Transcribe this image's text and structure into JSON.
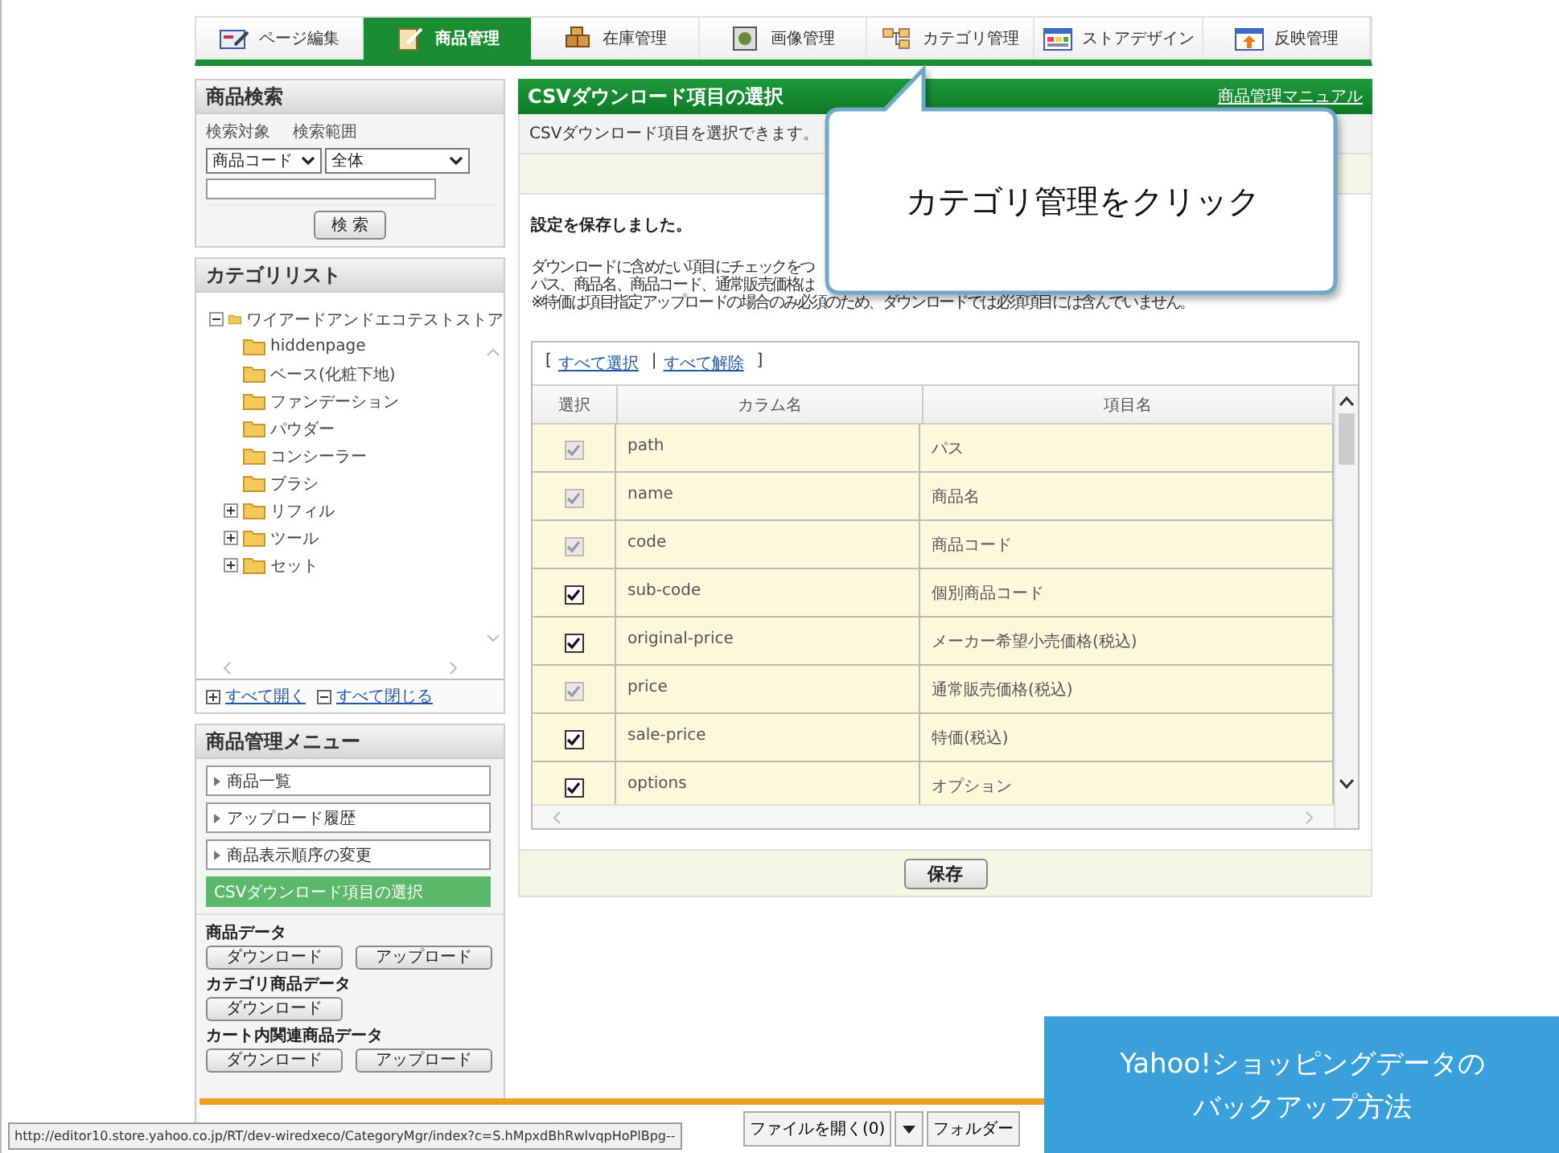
{
  "nav_tabs": [
    {
      "label": "ページ編集",
      "selected": false
    },
    {
      "label": "商品管理",
      "selected": true
    },
    {
      "label": "在庫管理",
      "selected": false
    },
    {
      "label": "画像管理",
      "selected": false
    },
    {
      "label": "カテゴリ管理",
      "selected": false
    },
    {
      "label": "ストアデザイン",
      "selected": false
    },
    {
      "label": "反映管理",
      "selected": false
    }
  ],
  "product_search": {
    "title": "商品検索",
    "target_label": "検索対象",
    "range_label": "検索範囲",
    "target_value": "商品コード",
    "range_value": "全体",
    "search_button": "検 索"
  },
  "category_list": {
    "title": "カテゴリリスト",
    "tree": [
      {
        "label": "ワイアードアンドエコテストストア",
        "expanded": true,
        "children": [
          {
            "label": "hiddenpage"
          },
          {
            "label": "ベース(化粧下地)"
          },
          {
            "label": "ファンデーション"
          },
          {
            "label": "パウダー"
          },
          {
            "label": "コンシーラー"
          },
          {
            "label": "ブラシ"
          },
          {
            "label": "リフィル",
            "expanded": false
          },
          {
            "label": "ツール",
            "expanded": false
          },
          {
            "label": "セット",
            "expanded": false
          }
        ]
      }
    ],
    "expand_all": "すべて開く",
    "collapse_all": "すべて閉じる"
  },
  "product_menu": {
    "title": "商品管理メニュー",
    "items": [
      {
        "label": "商品一覧",
        "selected": false
      },
      {
        "label": "アップロード履歴",
        "selected": false
      },
      {
        "label": "商品表示順序の変更",
        "selected": false
      },
      {
        "label": "CSVダウンロード項目の選択",
        "selected": true
      }
    ],
    "sections": [
      {
        "title": "商品データ",
        "buttons": [
          "ダウンロード",
          "アップロード"
        ]
      },
      {
        "title": "カテゴリ商品データ",
        "buttons": [
          "ダウンロード"
        ]
      },
      {
        "title": "カート内関連商品データ",
        "buttons": [
          "ダウンロード",
          "アップロード"
        ]
      }
    ]
  },
  "main": {
    "title": "CSVダウンロード項目の選択",
    "manual_link": "商品管理マニュアル",
    "description": "CSVダウンロード項目を選択できます。",
    "saved_message": "設定を保存しました。",
    "intro_lines": [
      "ダウンロードに含めたい項目にチェックをつ",
      "パス、商品名、商品コード、通常販売価格は",
      "※特価は項目指定アップロードの場合のみ必須のため、ダウンロードでは必須項目には含んでいません。"
    ],
    "bracket_open": "[",
    "select_all": "すべて選択",
    "separator": "|",
    "deselect_all": "すべて解除",
    "bracket_close": "]",
    "table": {
      "columns": [
        "選択",
        "カラム名",
        "項目名"
      ],
      "rows": [
        {
          "column": "path",
          "item": "パス",
          "checked": true,
          "disabled": true
        },
        {
          "column": "name",
          "item": "商品名",
          "checked": true,
          "disabled": true
        },
        {
          "column": "code",
          "item": "商品コード",
          "checked": true,
          "disabled": true
        },
        {
          "column": "sub-code",
          "item": "個別商品コード",
          "checked": true,
          "disabled": false
        },
        {
          "column": "original-price",
          "item": "メーカー希望小売価格(税込)",
          "checked": true,
          "disabled": false
        },
        {
          "column": "price",
          "item": "通常販売価格(税込)",
          "checked": true,
          "disabled": true
        },
        {
          "column": "sale-price",
          "item": "特価(税込)",
          "checked": true,
          "disabled": false
        },
        {
          "column": "options",
          "item": "オプション",
          "checked": true,
          "disabled": false
        }
      ]
    },
    "save_button": "保存"
  },
  "callout": {
    "text": "カテゴリ管理をクリック"
  },
  "download_bar": {
    "open_button": "ファイルを開く(0)",
    "folder_button": "フォルダー"
  },
  "status_url": "http://editor10.store.yahoo.co.jp/RT/dev-wiredxeco/CategoryMgr/index?c=S.hMpxdBhRwlvqpHoPlBpg--",
  "overlay_caption": {
    "lines": [
      "Yahoo!ショッピングデータの",
      "バックアップ方法"
    ]
  }
}
